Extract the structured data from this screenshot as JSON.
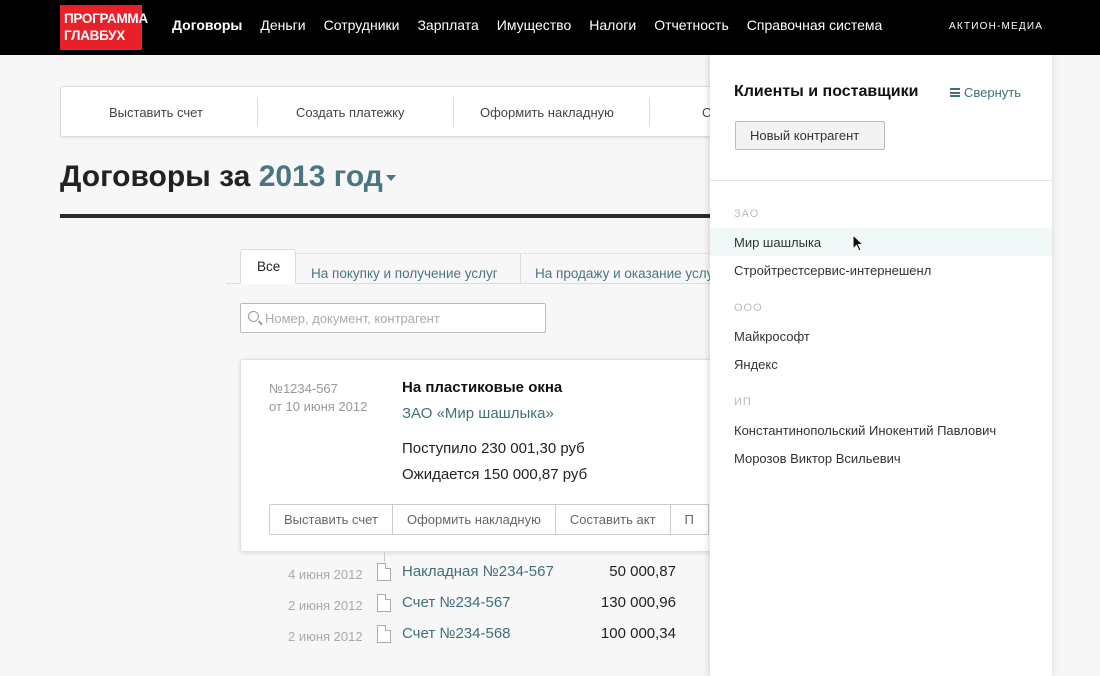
{
  "app": {
    "logo_line1": "ПРОГРАММА",
    "logo_line2": "ГЛАВБУХ",
    "brand": "АКТИОН-МЕДИА"
  },
  "nav": {
    "items": [
      {
        "label": "Договоры",
        "active": true
      },
      {
        "label": "Деньги"
      },
      {
        "label": "Сотрудники"
      },
      {
        "label": "Зарплата"
      },
      {
        "label": "Имущество"
      },
      {
        "label": "Налоги"
      },
      {
        "label": "Отчетность"
      },
      {
        "label": "Справочная система"
      }
    ]
  },
  "actions": {
    "items": [
      "Выставить счет",
      "Создать платежку",
      "Оформить накладную",
      "С"
    ]
  },
  "heading": {
    "prefix": "Договоры за",
    "year": "2013 год"
  },
  "tabs": [
    "Все",
    "На покупку и получение услуг",
    "На продажу и оказание услуг"
  ],
  "search": {
    "placeholder": "Номер, документ, контрагент",
    "value": ""
  },
  "contract": {
    "number": "№1234-567",
    "date": "от 10 июня 2012",
    "title": "На пластиковые окна",
    "party": "ЗАО «Мир шашлыка»",
    "received": "Поступило 230 001,30 руб",
    "expected": "Ожидается 150 000,87 руб",
    "buttons": [
      "Выставить счет",
      "Оформить накладную",
      "Составить акт",
      "П"
    ]
  },
  "documents": [
    {
      "date": "4 июня 2012",
      "name": "Накладная №234-567",
      "amount": "50 000,87"
    },
    {
      "date": "2 июня 2012",
      "name": "Счет №234-567",
      "amount": "130 000,96"
    },
    {
      "date": "2 июня 2012",
      "name": "Счет №234-568",
      "amount": "100 000,34"
    }
  ],
  "panel": {
    "title": "Клиенты и поставщики",
    "collapse_label": "Свернуть",
    "new_button": "Новый контрагент",
    "groups": [
      {
        "label": "ЗАО",
        "items": [
          "Мир шашлыка",
          "Стройтрестсервис-интернешенл"
        ]
      },
      {
        "label": "ООО",
        "items": [
          "Майкрософт",
          "Яндекс"
        ]
      },
      {
        "label": "ИП",
        "items": [
          "Константинопольский Инокентий Павлович",
          "Морозов Виктор Всильевич"
        ]
      }
    ],
    "hovered_item": "Мир шашлыка"
  },
  "colors": {
    "accent": "#4a7680",
    "logo_red": "#e8202a",
    "topbar": "#000000"
  }
}
